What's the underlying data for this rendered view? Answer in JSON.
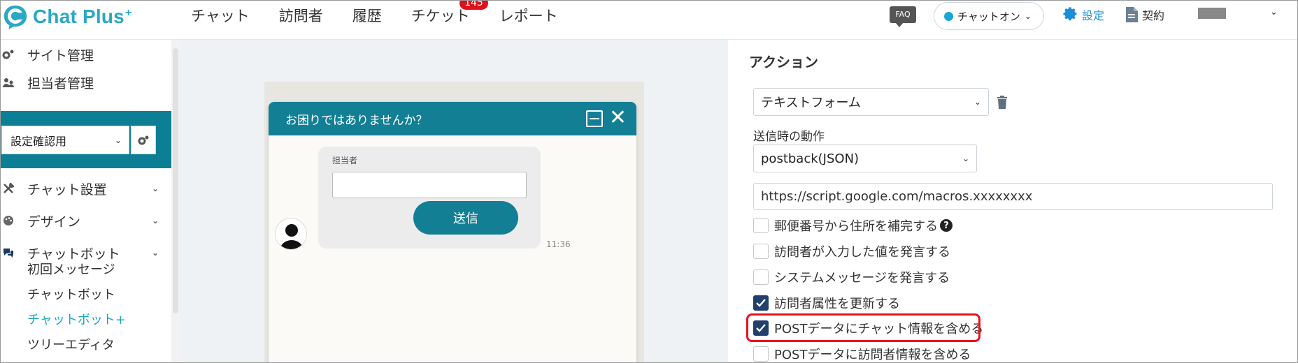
{
  "app": {
    "name": "Chat Plus",
    "name_plus": "+"
  },
  "nav": {
    "items": [
      "チャット",
      "訪問者",
      "履歴",
      "チケット",
      "レポート"
    ],
    "ticket_badge": "145"
  },
  "header": {
    "faq": "FAQ",
    "status": "チャットオン",
    "settings": "設定",
    "contract": "契約"
  },
  "sidebar": {
    "site_admin": "サイト管理",
    "staff_admin": "担当者管理",
    "select_value": "設定確認用",
    "chat_settings": "チャット設置",
    "design": "デザイン",
    "chatbot": "チャットボット",
    "sub_items": [
      "初回メッセージ",
      "チャットボット",
      "チャットボット+",
      "ツリーエディタ"
    ]
  },
  "preview": {
    "window_title": "お困りではありませんか？",
    "field_label": "担当者",
    "send_button": "送信",
    "time": "11:36"
  },
  "panel": {
    "title": "アクション",
    "action_type": "テキストフォーム",
    "submit_label": "送信時の動作",
    "submit_method": "postback(JSON)",
    "url": "https://script.google.com/macros.xxxxxxxx",
    "checkboxes": [
      {
        "label": "郵便番号から住所を補完する",
        "checked": false
      },
      {
        "label": "訪問者が入力した値を発言する",
        "checked": false
      },
      {
        "label": "システムメッセージを発言する",
        "checked": false
      },
      {
        "label": "訪問者属性を更新する",
        "checked": true
      },
      {
        "label": "POSTデータにチャット情報を含める",
        "checked": true
      },
      {
        "label": "POSTデータに訪問者情報を含める",
        "checked": false
      }
    ]
  },
  "colors": {
    "brand": "#2aa8c6",
    "teal": "#137f95",
    "badge": "#e0101b",
    "check": "#203f6b",
    "highlight": "#e8141c"
  }
}
